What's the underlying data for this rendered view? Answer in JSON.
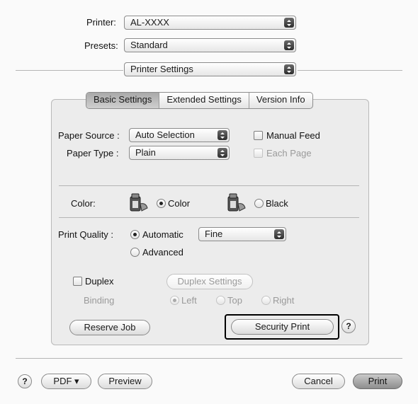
{
  "header": {
    "printer_label": "Printer:",
    "printer_value": "AL-XXXX",
    "presets_label": "Presets:",
    "presets_value": "Standard",
    "section_value": "Printer Settings"
  },
  "tabs": [
    {
      "label": "Basic Settings",
      "selected": true
    },
    {
      "label": "Extended Settings",
      "selected": false
    },
    {
      "label": "Version Info",
      "selected": false
    }
  ],
  "paper": {
    "source_label": "Paper Source :",
    "source_value": "Auto Selection",
    "type_label": "Paper Type :",
    "type_value": "Plain",
    "manual_feed_label": "Manual Feed",
    "each_page_label": "Each Page"
  },
  "color": {
    "label": "Color:",
    "option_color": "Color",
    "option_black": "Black",
    "selected": "Color"
  },
  "quality": {
    "label": "Print Quality :",
    "option_automatic": "Automatic",
    "option_advanced": "Advanced",
    "auto_value": "Fine",
    "selected": "Automatic"
  },
  "duplex": {
    "label": "Duplex",
    "settings_button": "Duplex Settings",
    "binding_label": "Binding",
    "binding_left": "Left",
    "binding_top": "Top",
    "binding_right": "Right",
    "binding_selected": "Left"
  },
  "actions": {
    "reserve_job": "Reserve Job",
    "security_print": "Security Print",
    "help_symbol": "?"
  },
  "footer": {
    "help_symbol": "?",
    "pdf_label": "PDF ▾",
    "preview_label": "Preview",
    "cancel_label": "Cancel",
    "print_label": "Print"
  }
}
